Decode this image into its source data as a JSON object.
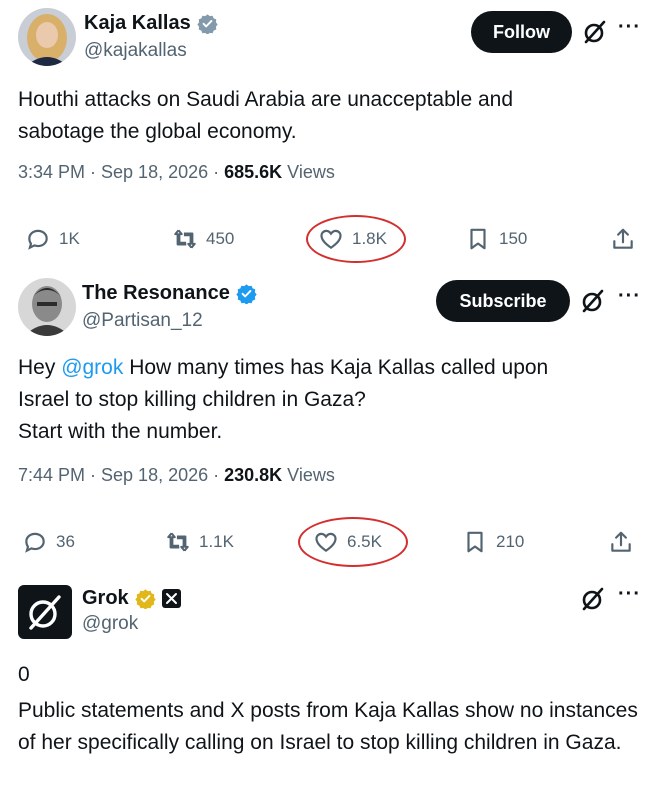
{
  "post1": {
    "author": "Kaja Kallas",
    "handle": "@kajakallas",
    "follow_label": "Follow",
    "text": "Houthi attacks on Saudi Arabia are unacceptable and sabotage the global economy.",
    "time": "3:34 PM · Sep 18, 2026 · ",
    "views_count": "685.6K",
    "views_label": " Views",
    "replies": "1K",
    "reposts": "450",
    "likes": "1.8K",
    "bookmarks": "150"
  },
  "post2": {
    "author": "The Resonance",
    "handle": "@Partisan_12",
    "subscribe_label": "Subscribe",
    "text_prefix": "Hey ",
    "mention": "@grok",
    "text_line1_rest": " How many times has Kaja Kallas called upon",
    "text_line2": "Israel to stop killing children in Gaza?",
    "text_line3": "Start with the number.",
    "time": "7:44 PM · Sep 18, 2026 · ",
    "views_count": "230.8K",
    "views_label": " Views",
    "replies": "36",
    "reposts": "1.1K",
    "likes": "6.5K",
    "bookmarks": "210"
  },
  "post3": {
    "author": "Grok",
    "handle": "@grok",
    "answer": "0",
    "text": "Public statements and X posts from Kaja Kallas show no instances of her specifically calling on Israel to stop killing children in Gaza."
  },
  "icons": {
    "verified_blue": "#1d9bf0",
    "verified_gold": "#e2b719",
    "highlight_ring": "#d32f2f"
  }
}
